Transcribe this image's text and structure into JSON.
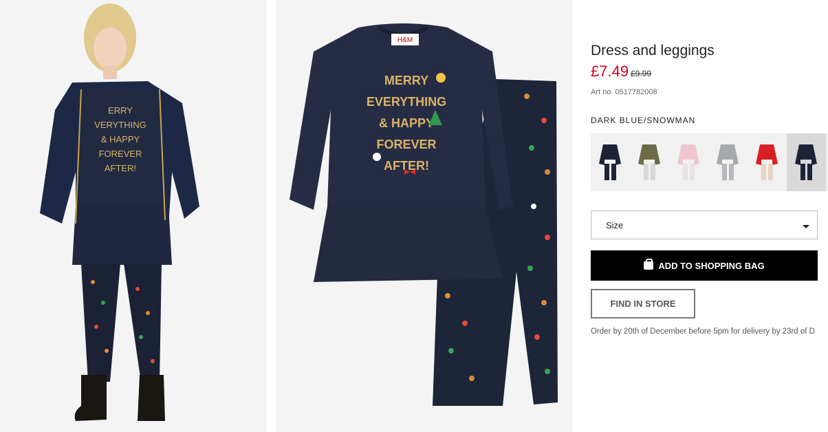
{
  "product": {
    "title": "Dress and leggings",
    "price": "£7.49",
    "old_price": "£9.99",
    "article": "Art no. 0517782008",
    "color_name": "DARK BLUE/SNOWMAN"
  },
  "colors": {
    "accent": "#d6001c",
    "button_bg": "#000000",
    "navy": "#1e2438",
    "gold_print": "#d9b36a"
  },
  "images": {
    "front_print": [
      "MERRY",
      "EVERYTHING",
      "& HAPPY",
      "FOREVER",
      "AFTER!"
    ],
    "brand_tag": "H&M"
  },
  "swatches": [
    {
      "name": "dark-blue",
      "color": "#1e2438",
      "selected": false
    },
    {
      "name": "khaki",
      "color": "#6b6b45",
      "selected": false
    },
    {
      "name": "light-pink",
      "color": "#efc6cf",
      "selected": false
    },
    {
      "name": "grey",
      "color": "#a7a9ad",
      "selected": false
    },
    {
      "name": "red",
      "color": "#d81f26",
      "selected": false
    },
    {
      "name": "dark-blue-snowman",
      "color": "#1e2438",
      "selected": true
    }
  ],
  "size": {
    "label": "Size"
  },
  "actions": {
    "add_to_bag": "ADD TO SHOPPING BAG",
    "find_in_store": "FIND IN STORE"
  },
  "delivery_note": "Order by 20th of December before 5pm for delivery by 23rd of D"
}
